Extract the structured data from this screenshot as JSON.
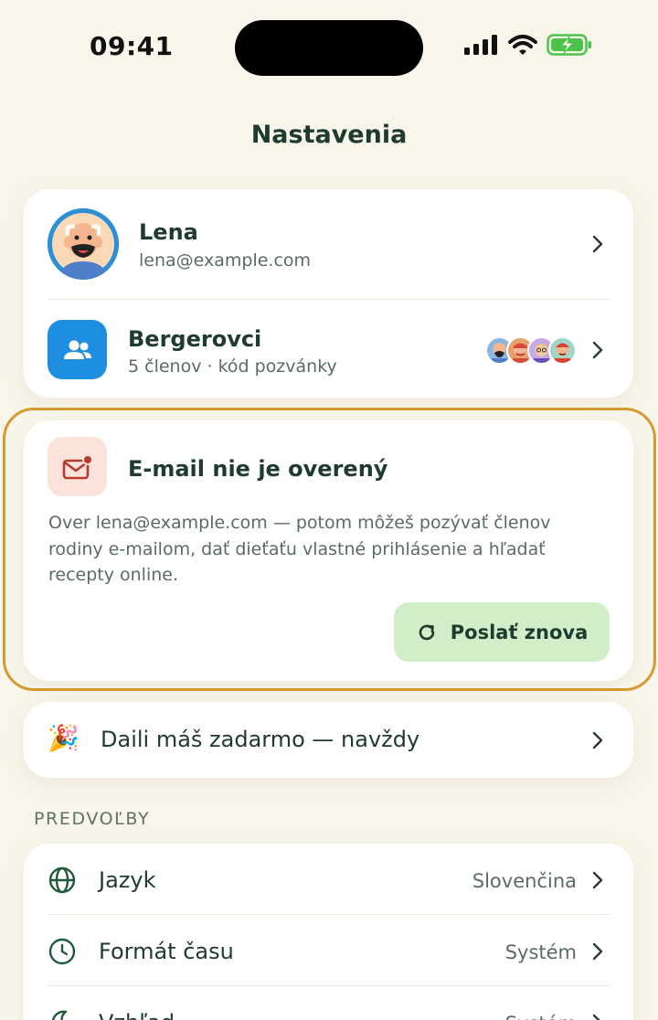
{
  "status_bar": {
    "time": "09:41"
  },
  "page": {
    "title": "Nastavenia"
  },
  "profile": {
    "name": "Lena",
    "email": "lena@example.com"
  },
  "family": {
    "name": "Bergerovci",
    "subtitle": "5 členov · kód pozvánky"
  },
  "verify": {
    "title": "E-mail nie je overený",
    "body": "Over lena@example.com — potom môžeš pozývať členov rodiny e-mailom, dať dieťaťu vlastné prihlásenie a hľadať recepty online.",
    "button_label": "Poslať znova"
  },
  "promo": {
    "label": "Daili máš zadarmo — navždy"
  },
  "preferences": {
    "section_label": "PREDVOĽBY",
    "items": [
      {
        "label": "Jazyk",
        "value": "Slovenčina",
        "icon": "globe-icon"
      },
      {
        "label": "Formát času",
        "value": "Systém",
        "icon": "clock-icon"
      },
      {
        "label": "Vzhľad",
        "value": "Systém",
        "icon": "moon-icon"
      }
    ]
  },
  "colors": {
    "background": "#f8f5ea",
    "text_primary": "#1f3a2e",
    "accent_blue": "#1e8fe0",
    "warning_outline": "#d79a30",
    "resend_button": "#d2eec8",
    "mail_badge": "#fbe3dc"
  }
}
